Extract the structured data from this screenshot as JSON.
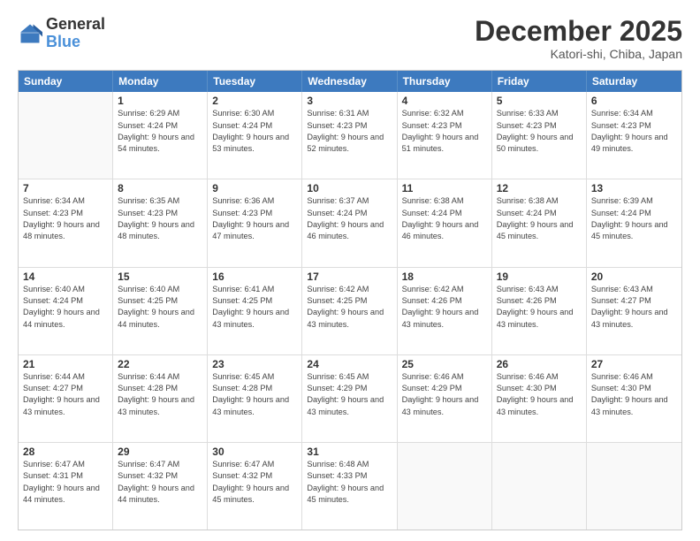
{
  "header": {
    "logo_general": "General",
    "logo_blue": "Blue",
    "month_title": "December 2025",
    "location": "Katori-shi, Chiba, Japan"
  },
  "calendar": {
    "weekdays": [
      "Sunday",
      "Monday",
      "Tuesday",
      "Wednesday",
      "Thursday",
      "Friday",
      "Saturday"
    ],
    "rows": [
      [
        {
          "day": "",
          "empty": true
        },
        {
          "day": "1",
          "sunrise": "Sunrise: 6:29 AM",
          "sunset": "Sunset: 4:24 PM",
          "daylight": "Daylight: 9 hours and 54 minutes."
        },
        {
          "day": "2",
          "sunrise": "Sunrise: 6:30 AM",
          "sunset": "Sunset: 4:24 PM",
          "daylight": "Daylight: 9 hours and 53 minutes."
        },
        {
          "day": "3",
          "sunrise": "Sunrise: 6:31 AM",
          "sunset": "Sunset: 4:23 PM",
          "daylight": "Daylight: 9 hours and 52 minutes."
        },
        {
          "day": "4",
          "sunrise": "Sunrise: 6:32 AM",
          "sunset": "Sunset: 4:23 PM",
          "daylight": "Daylight: 9 hours and 51 minutes."
        },
        {
          "day": "5",
          "sunrise": "Sunrise: 6:33 AM",
          "sunset": "Sunset: 4:23 PM",
          "daylight": "Daylight: 9 hours and 50 minutes."
        },
        {
          "day": "6",
          "sunrise": "Sunrise: 6:34 AM",
          "sunset": "Sunset: 4:23 PM",
          "daylight": "Daylight: 9 hours and 49 minutes."
        }
      ],
      [
        {
          "day": "7",
          "sunrise": "Sunrise: 6:34 AM",
          "sunset": "Sunset: 4:23 PM",
          "daylight": "Daylight: 9 hours and 48 minutes."
        },
        {
          "day": "8",
          "sunrise": "Sunrise: 6:35 AM",
          "sunset": "Sunset: 4:23 PM",
          "daylight": "Daylight: 9 hours and 48 minutes."
        },
        {
          "day": "9",
          "sunrise": "Sunrise: 6:36 AM",
          "sunset": "Sunset: 4:23 PM",
          "daylight": "Daylight: 9 hours and 47 minutes."
        },
        {
          "day": "10",
          "sunrise": "Sunrise: 6:37 AM",
          "sunset": "Sunset: 4:24 PM",
          "daylight": "Daylight: 9 hours and 46 minutes."
        },
        {
          "day": "11",
          "sunrise": "Sunrise: 6:38 AM",
          "sunset": "Sunset: 4:24 PM",
          "daylight": "Daylight: 9 hours and 46 minutes."
        },
        {
          "day": "12",
          "sunrise": "Sunrise: 6:38 AM",
          "sunset": "Sunset: 4:24 PM",
          "daylight": "Daylight: 9 hours and 45 minutes."
        },
        {
          "day": "13",
          "sunrise": "Sunrise: 6:39 AM",
          "sunset": "Sunset: 4:24 PM",
          "daylight": "Daylight: 9 hours and 45 minutes."
        }
      ],
      [
        {
          "day": "14",
          "sunrise": "Sunrise: 6:40 AM",
          "sunset": "Sunset: 4:24 PM",
          "daylight": "Daylight: 9 hours and 44 minutes."
        },
        {
          "day": "15",
          "sunrise": "Sunrise: 6:40 AM",
          "sunset": "Sunset: 4:25 PM",
          "daylight": "Daylight: 9 hours and 44 minutes."
        },
        {
          "day": "16",
          "sunrise": "Sunrise: 6:41 AM",
          "sunset": "Sunset: 4:25 PM",
          "daylight": "Daylight: 9 hours and 43 minutes."
        },
        {
          "day": "17",
          "sunrise": "Sunrise: 6:42 AM",
          "sunset": "Sunset: 4:25 PM",
          "daylight": "Daylight: 9 hours and 43 minutes."
        },
        {
          "day": "18",
          "sunrise": "Sunrise: 6:42 AM",
          "sunset": "Sunset: 4:26 PM",
          "daylight": "Daylight: 9 hours and 43 minutes."
        },
        {
          "day": "19",
          "sunrise": "Sunrise: 6:43 AM",
          "sunset": "Sunset: 4:26 PM",
          "daylight": "Daylight: 9 hours and 43 minutes."
        },
        {
          "day": "20",
          "sunrise": "Sunrise: 6:43 AM",
          "sunset": "Sunset: 4:27 PM",
          "daylight": "Daylight: 9 hours and 43 minutes."
        }
      ],
      [
        {
          "day": "21",
          "sunrise": "Sunrise: 6:44 AM",
          "sunset": "Sunset: 4:27 PM",
          "daylight": "Daylight: 9 hours and 43 minutes."
        },
        {
          "day": "22",
          "sunrise": "Sunrise: 6:44 AM",
          "sunset": "Sunset: 4:28 PM",
          "daylight": "Daylight: 9 hours and 43 minutes."
        },
        {
          "day": "23",
          "sunrise": "Sunrise: 6:45 AM",
          "sunset": "Sunset: 4:28 PM",
          "daylight": "Daylight: 9 hours and 43 minutes."
        },
        {
          "day": "24",
          "sunrise": "Sunrise: 6:45 AM",
          "sunset": "Sunset: 4:29 PM",
          "daylight": "Daylight: 9 hours and 43 minutes."
        },
        {
          "day": "25",
          "sunrise": "Sunrise: 6:46 AM",
          "sunset": "Sunset: 4:29 PM",
          "daylight": "Daylight: 9 hours and 43 minutes."
        },
        {
          "day": "26",
          "sunrise": "Sunrise: 6:46 AM",
          "sunset": "Sunset: 4:30 PM",
          "daylight": "Daylight: 9 hours and 43 minutes."
        },
        {
          "day": "27",
          "sunrise": "Sunrise: 6:46 AM",
          "sunset": "Sunset: 4:30 PM",
          "daylight": "Daylight: 9 hours and 43 minutes."
        }
      ],
      [
        {
          "day": "28",
          "sunrise": "Sunrise: 6:47 AM",
          "sunset": "Sunset: 4:31 PM",
          "daylight": "Daylight: 9 hours and 44 minutes."
        },
        {
          "day": "29",
          "sunrise": "Sunrise: 6:47 AM",
          "sunset": "Sunset: 4:32 PM",
          "daylight": "Daylight: 9 hours and 44 minutes."
        },
        {
          "day": "30",
          "sunrise": "Sunrise: 6:47 AM",
          "sunset": "Sunset: 4:32 PM",
          "daylight": "Daylight: 9 hours and 45 minutes."
        },
        {
          "day": "31",
          "sunrise": "Sunrise: 6:48 AM",
          "sunset": "Sunset: 4:33 PM",
          "daylight": "Daylight: 9 hours and 45 minutes."
        },
        {
          "day": "",
          "empty": true
        },
        {
          "day": "",
          "empty": true
        },
        {
          "day": "",
          "empty": true
        }
      ]
    ]
  }
}
